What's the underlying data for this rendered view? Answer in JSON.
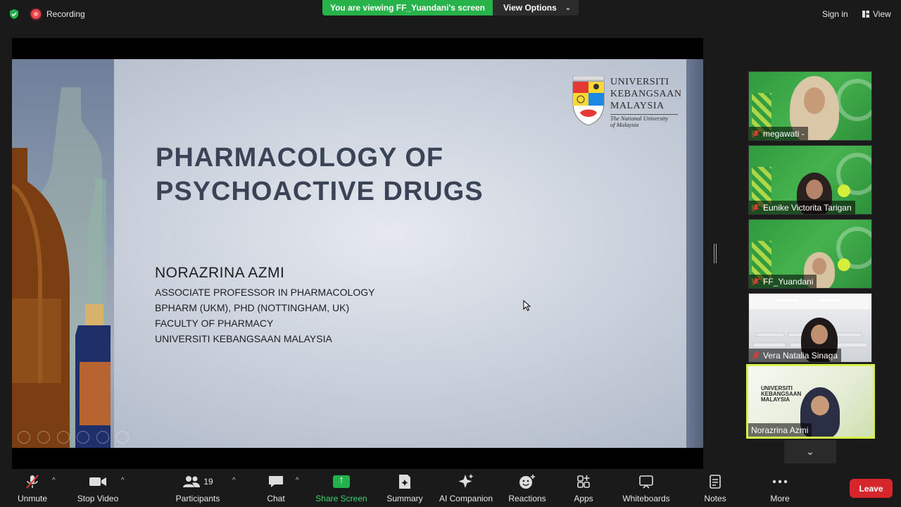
{
  "topbar": {
    "recording_label": "Recording",
    "viewing_banner": "You are viewing FF_Yuandani's screen",
    "view_options_label": "View Options",
    "sign_in_label": "Sign in",
    "view_label": "View"
  },
  "slide": {
    "title_line1": "PHARMACOLOGY OF",
    "title_line2": "PSYCHOACTIVE DRUGS",
    "presenter": "NORAZRINA AZMI",
    "details": [
      "ASSOCIATE PROFESSOR IN PHARMACOLOGY",
      "BPHARM (UKM), PHD (NOTTINGHAM, UK)",
      "FACULTY OF PHARMACY",
      "UNIVERSITI KEBANGSAAN MALAYSIA"
    ],
    "logo": {
      "line1": "UNIVERSITI",
      "line2": "KEBANGSAAN",
      "line3": "MALAYSIA",
      "tagline1": "The National University",
      "tagline2": "of Malaysia"
    }
  },
  "participants_tiles": [
    {
      "name": "megawati -"
    },
    {
      "name": "Eunike Victorita Tarigan"
    },
    {
      "name": "FF_Yuandani"
    },
    {
      "name": "Vera Natalia Sinaga"
    },
    {
      "name": "Norazrina Azmi",
      "bg_line1": "UNIVERSITI",
      "bg_line2": "KEBANGSAAN",
      "bg_line3": "MALAYSIA"
    }
  ],
  "toolbar": {
    "unmute": "Unmute",
    "stop_video": "Stop Video",
    "participants": "Participants",
    "participants_count": "19",
    "chat": "Chat",
    "share_screen": "Share Screen",
    "summary": "Summary",
    "ai_companion": "AI Companion",
    "reactions": "Reactions",
    "apps": "Apps",
    "whiteboards": "Whiteboards",
    "notes": "Notes",
    "more": "More",
    "leave": "Leave"
  },
  "colors": {
    "green_banner": "#27b24a",
    "leave_red": "#d6262c",
    "active_speaker_border": "#d6f24a"
  }
}
